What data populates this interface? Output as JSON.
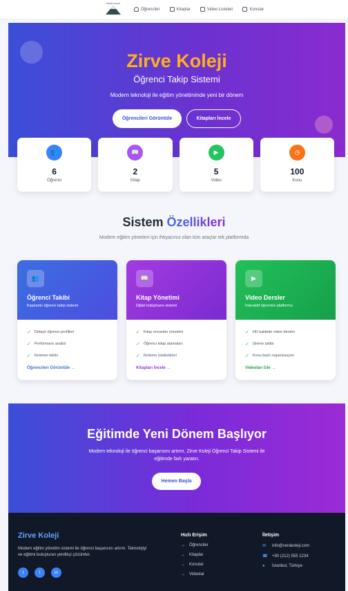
{
  "nav": {
    "logo_text": "ZİRVE KOLEJİ",
    "items": [
      {
        "label": "Öğrenciler",
        "icon": "user-icon"
      },
      {
        "label": "Kitaplar",
        "icon": "book-icon"
      },
      {
        "label": "Video Listeleri",
        "icon": "video-icon"
      },
      {
        "label": "Konular",
        "icon": "note-icon"
      }
    ]
  },
  "hero": {
    "title": "Zirve Koleji",
    "subtitle": "Öğrenci Takip Sistemi",
    "description": "Modern teknoloji ile eğitim yönetiminde yeni bir dönem",
    "primary_button": "Öğrencileri Görüntüle",
    "secondary_button": "Kitapları İncele"
  },
  "stats": [
    {
      "value": "6",
      "label": "Öğrenci",
      "color": "#3b82f6",
      "icon": "users-icon"
    },
    {
      "value": "2",
      "label": "Kitap",
      "color": "#a855f7",
      "icon": "book-icon"
    },
    {
      "value": "5",
      "label": "Video",
      "color": "#22c55e",
      "icon": "video-icon"
    },
    {
      "value": "100",
      "label": "Konu",
      "color": "#f97316",
      "icon": "clock-icon"
    }
  ],
  "features": {
    "title_plain": "Sistem",
    "title_accent": "Özellikleri",
    "description": "Modern eğitim yönetimi için ihtiyacınız olan tüm araçlar tek platformda",
    "cards": [
      {
        "title": "Öğrenci Takibi",
        "subtitle": "Kapsamlı öğrenci takip sistemi",
        "items": [
          "Detaylı öğrenci profilleri",
          "Performans analizi",
          "İlerleme takibi"
        ],
        "link": "Öğrencileri Görüntüle"
      },
      {
        "title": "Kitap Yönetimi",
        "subtitle": "Dijital kütüphane sistemi",
        "items": [
          "Kitap envanter yönetimi",
          "Öğrenci kitap atamaları",
          "İlerleme istatistikleri"
        ],
        "link": "Kitapları İncele"
      },
      {
        "title": "Video Dersler",
        "subtitle": "İnteraktif öğrenme platformu",
        "items": [
          "HD kalitede video dersler",
          "İzleme takibi",
          "Konu bazlı organizasyon"
        ],
        "link": "Videoları İzle"
      }
    ]
  },
  "cta": {
    "title": "Eğitimde Yeni Dönem Başlıyor",
    "description": "Modern teknoloji ile öğrenci başarısını artırın. Zirve Koleji Öğrenci Takip Sistemi ile eğitimde fark yaratın.",
    "button": "Hemen Başla"
  },
  "footer": {
    "brand": "Zirve Koleji",
    "description": "Modern eğitim yönetim sistemi ile öğrenci başarısını artırın. Teknolojiyi ve eğitimi buluşturan yenilikçi çözümler.",
    "quick_links_title": "Hızlı Erişim",
    "quick_links": [
      "Öğrenciler",
      "Kitaplar",
      "Konular",
      "Videolar"
    ],
    "contact_title": "İletişim",
    "email": "info@verakoleji.com",
    "phone": "+90 (212) 555 1234",
    "address": "İstanbul, Türkiye"
  }
}
